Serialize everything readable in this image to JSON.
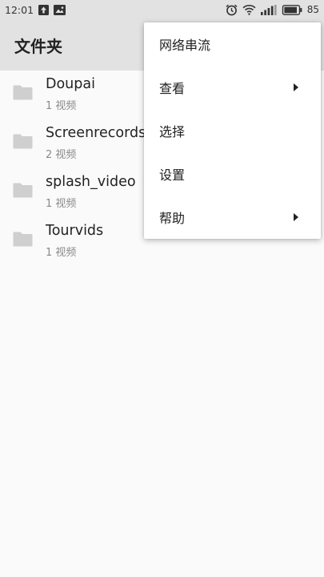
{
  "status_bar": {
    "time": "12:01",
    "battery": "85",
    "icons": [
      "upload-notification-icon",
      "image-notification-icon",
      "alarm-icon",
      "wifi-icon",
      "signal-icon",
      "battery-icon"
    ]
  },
  "app_bar": {
    "title": "文件夹"
  },
  "folders": [
    {
      "name": "Doupai",
      "count": "1 视频"
    },
    {
      "name": "Screenrecords",
      "count": "2 视频"
    },
    {
      "name": "splash_video",
      "count": "1 视频"
    },
    {
      "name": "Tourvids",
      "count": "1 视频"
    }
  ],
  "menu": {
    "items": [
      {
        "label": "网络串流",
        "submenu": false
      },
      {
        "label": "查看",
        "submenu": true
      },
      {
        "label": "选择",
        "submenu": false
      },
      {
        "label": "设置",
        "submenu": false
      },
      {
        "label": "帮助",
        "submenu": true
      }
    ]
  },
  "colors": {
    "bar_bg": "#e2e2e2",
    "page_bg": "#fafafa",
    "folder_icon": "#cfcfcf"
  }
}
